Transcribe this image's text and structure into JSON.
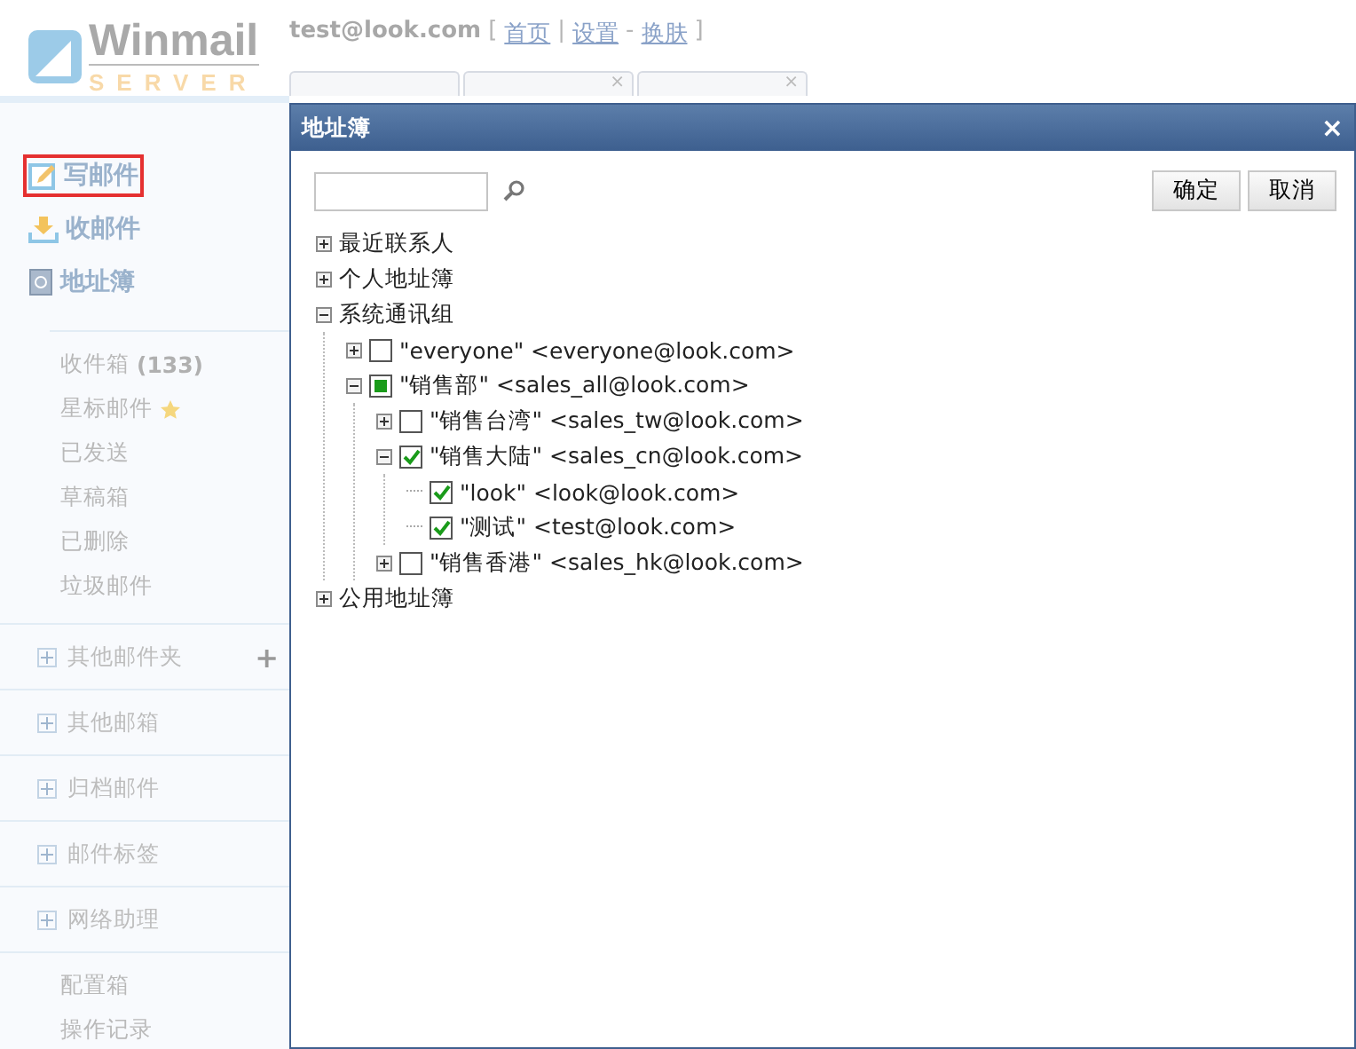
{
  "header": {
    "logo_main": "Winmail",
    "logo_sub": "SERVER",
    "user": "test@look.com",
    "links": [
      {
        "label": "首页"
      },
      {
        "label": "设置"
      },
      {
        "label": "换肤"
      }
    ],
    "separators": [
      "[",
      "|",
      "-",
      "]"
    ]
  },
  "tabs": [
    {
      "close": "×"
    },
    {
      "close": "×"
    }
  ],
  "sidebar": {
    "actions": [
      {
        "label": "写邮件",
        "highlighted": true
      },
      {
        "label": "收邮件",
        "highlighted": false
      },
      {
        "label": "地址簿",
        "highlighted": false
      }
    ],
    "folders": [
      {
        "label": "收件箱",
        "count": "(133)",
        "starred": false
      },
      {
        "label": "星标邮件",
        "starred": true
      },
      {
        "label": "已发送",
        "starred": false
      },
      {
        "label": "草稿箱",
        "starred": false
      },
      {
        "label": "已删除",
        "starred": false
      },
      {
        "label": "垃圾邮件",
        "starred": false
      }
    ],
    "sections": [
      {
        "label": "其他邮件夹",
        "add": "+"
      },
      {
        "label": "其他邮箱"
      },
      {
        "label": "归档邮件"
      },
      {
        "label": "邮件标签"
      },
      {
        "label": "网络助理"
      }
    ],
    "footer": [
      {
        "label": "配置箱"
      },
      {
        "label": "操作记录"
      }
    ]
  },
  "dialog": {
    "title": "地址簿",
    "close": "×",
    "buttons": [
      {
        "label": "确定"
      },
      {
        "label": "取消"
      }
    ],
    "tree": [
      {
        "label": "最近联系人",
        "expanded": false
      },
      {
        "label": "个人地址簿",
        "expanded": false
      },
      {
        "label": "系统通讯组",
        "expanded": true,
        "children": [
          {
            "label": "\"everyone\" <everyone@look.com>",
            "expanded": false,
            "checked": false,
            "partial": false
          },
          {
            "label": "\"销售部\" <sales_all@look.com>",
            "expanded": true,
            "checked": false,
            "partial": true,
            "children": [
              {
                "label": "\"销售台湾\" <sales_tw@look.com>",
                "expanded": false,
                "checked": false,
                "partial": false
              },
              {
                "label": "\"销售大陆\" <sales_cn@look.com>",
                "expanded": true,
                "checked": true,
                "partial": false,
                "children": [
                  {
                    "label": "\"look\" <look@look.com>",
                    "checked": true,
                    "partial": false
                  },
                  {
                    "label": "\"测试\" <test@look.com>",
                    "checked": true,
                    "partial": false
                  }
                ]
              },
              {
                "label": "\"销售香港\" <sales_hk@look.com>",
                "expanded": false,
                "checked": false,
                "partial": false
              }
            ]
          }
        ]
      },
      {
        "label": "公用地址簿",
        "expanded": false
      }
    ]
  }
}
